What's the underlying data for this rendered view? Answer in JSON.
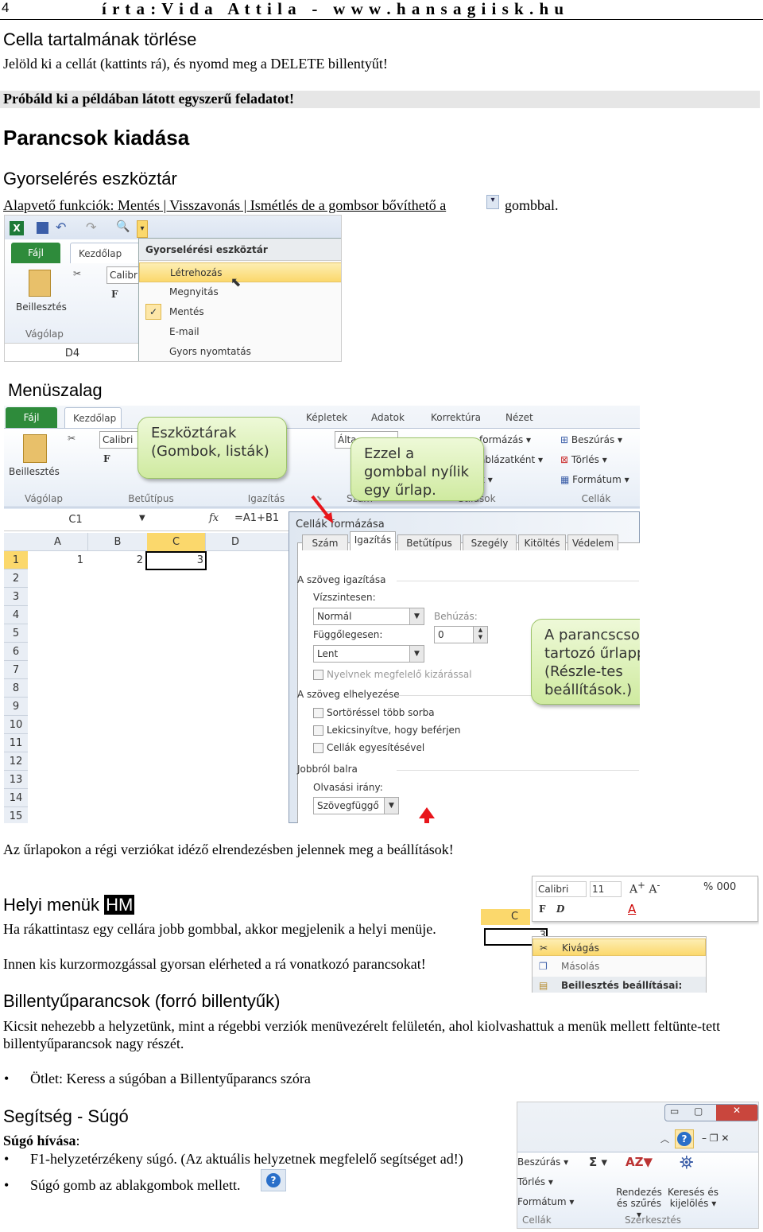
{
  "header": {
    "page_number": "4",
    "title": "í r t a : V i d a   A t t i l a   -   w w w . h a n s a g i i s k . h u"
  },
  "s1": {
    "heading": "Cella tartalmának törlése",
    "text": "Jelöld ki a cellát (kattints rá), és nyomd meg a DELETE billentyűt!",
    "task": "Próbáld ki a példában látott egyszerű feladatot!"
  },
  "s2": {
    "heading": "Parancsok kiadása"
  },
  "s3": {
    "heading": "Gyorselérés eszköztár",
    "text_before": "Alapvető funkciók: Mentés | Visszavonás | Ismétlés  de a gombsor bővíthető a",
    "text_after": "gombbal."
  },
  "qat": {
    "tabs": [
      "Fájl",
      "Kezdőlap"
    ],
    "font": "Calibri",
    "paste": "Beillesztés",
    "group": "Vágólap",
    "cell": "D4",
    "menu_title": "Gyorselérési eszköztár testreszabása",
    "items": [
      {
        "label": "Létrehozás",
        "checked": false,
        "highlighted": true
      },
      {
        "label": "Megnyitás",
        "checked": false
      },
      {
        "label": "Mentés",
        "checked": true
      },
      {
        "label": "E-mail",
        "checked": false
      },
      {
        "label": "Gyors nyomtatás",
        "checked": false
      }
    ]
  },
  "s4": {
    "heading": "Menüszalag"
  },
  "ribbon": {
    "tabs": [
      "Fájl",
      "Kezdőlap",
      "Képletek",
      "Adatok",
      "Korrektúra",
      "Nézet"
    ],
    "groups": [
      "Vágólap",
      "Betűtípus",
      "Igazítás",
      "Szám",
      "Stílusok",
      "Cellák"
    ],
    "paste": "Beillesztés",
    "font": "Calibri",
    "number_format": "Álta",
    "styles": [
      "formázás ▾",
      "áblázatként ▾",
      "k ▾"
    ],
    "cells": [
      "Beszúrás ▾",
      "Törlés ▾",
      "Formátum ▾"
    ],
    "name_box": "C1",
    "fx": "fx",
    "formula": "=A1+B1",
    "columns": [
      "A",
      "B",
      "C",
      "D"
    ],
    "rows": [
      "1",
      "2",
      "3",
      "4",
      "5",
      "6",
      "7",
      "8",
      "9",
      "10",
      "11",
      "12",
      "13",
      "14",
      "15"
    ],
    "cells_values": [
      "1",
      "2",
      "3"
    ]
  },
  "callouts": {
    "toolbars": "Eszköztárak (Gombok, listák)",
    "button": "Ezzel a gombbal nyílik egy űrlap.",
    "form": "A parancscsoporthoz tartozó űrlappal. (Részle-tes beállítások.)"
  },
  "dialog": {
    "title": "Cellák formázása",
    "tabs": [
      "Szám",
      "Igazítás",
      "Betűtípus",
      "Szegély",
      "Kitöltés",
      "Védelem"
    ],
    "active_tab": "Igazítás",
    "sec_align": "A szöveg igazítása",
    "horiz_label": "Vízszintesen:",
    "horiz_value": "Normál",
    "indent_label": "Behúzás:",
    "indent_value": "0",
    "vert_label": "Függőlegesen:",
    "vert_value": "Lent",
    "justify": "Nyelvnek megfelelő kizárással",
    "sec_control": "A szöveg elhelyezése",
    "wrap": "Sortöréssel több sorba",
    "shrink": "Lekicsinyítve, hogy beférjen",
    "merge": "Cellák egyesítésével",
    "sec_rtl": "Jobbról balra",
    "dir_label": "Olvasási irány:",
    "dir_value": "Szövegfüggő"
  },
  "note_forms": "Az űrlapokon a régi verziókat idéző elrendezésben jelennek meg a beállítások!",
  "s5": {
    "heading": "Helyi menük",
    "badge": "HM",
    "text1": "Ha rákattintasz egy cellára jobb gombbal, akkor megjelenik a helyi menüje.",
    "text2": "Innen kis kurzormozgással gyorsan elérheted a rá vonatkozó parancsokat!"
  },
  "ctx": {
    "font": "Calibri",
    "size": "11",
    "col": "C",
    "cell": "3",
    "bold": "F",
    "italic": "D",
    "items": [
      "Kivágás",
      "Másolás",
      "Beillesztés beállításai:"
    ]
  },
  "s6": {
    "heading": "Billentyűparancsok (forró billentyűk)",
    "text": "Kicsit nehezebb a helyzetünk, mint a régebbi verziók menüvezérelt felületén, ahol kiolvashattuk a menük mellett feltünte-tett billentyűparancsok nagy részét.",
    "bullet": "Ötlet: Keress a súgóban a Billentyűparancs szóra"
  },
  "s7": {
    "heading": "Segítség - Súgó",
    "sub": "Súgó hívása",
    "colon": ":",
    "bullets": [
      "F1-helyzetérzékeny súgó. (Az aktuális helyzetnek megfelelő segítséget ad!)",
      "Súgó gomb az ablakgombok mellett."
    ]
  },
  "help": {
    "cells": [
      "Beszúrás ▾",
      "Törlés ▾",
      "Formátum ▾"
    ],
    "cells_group": "Cellák",
    "sort": "Rendezés és szűrés ▾",
    "find": "Keresés és kijelölés ▾",
    "edit_group": "Szerkesztés"
  },
  "colors": {
    "file_tab": "#2e8b3b",
    "callout": "#d8eeb0",
    "arrow": "#e8151b",
    "highlight": "#fbd86c"
  }
}
